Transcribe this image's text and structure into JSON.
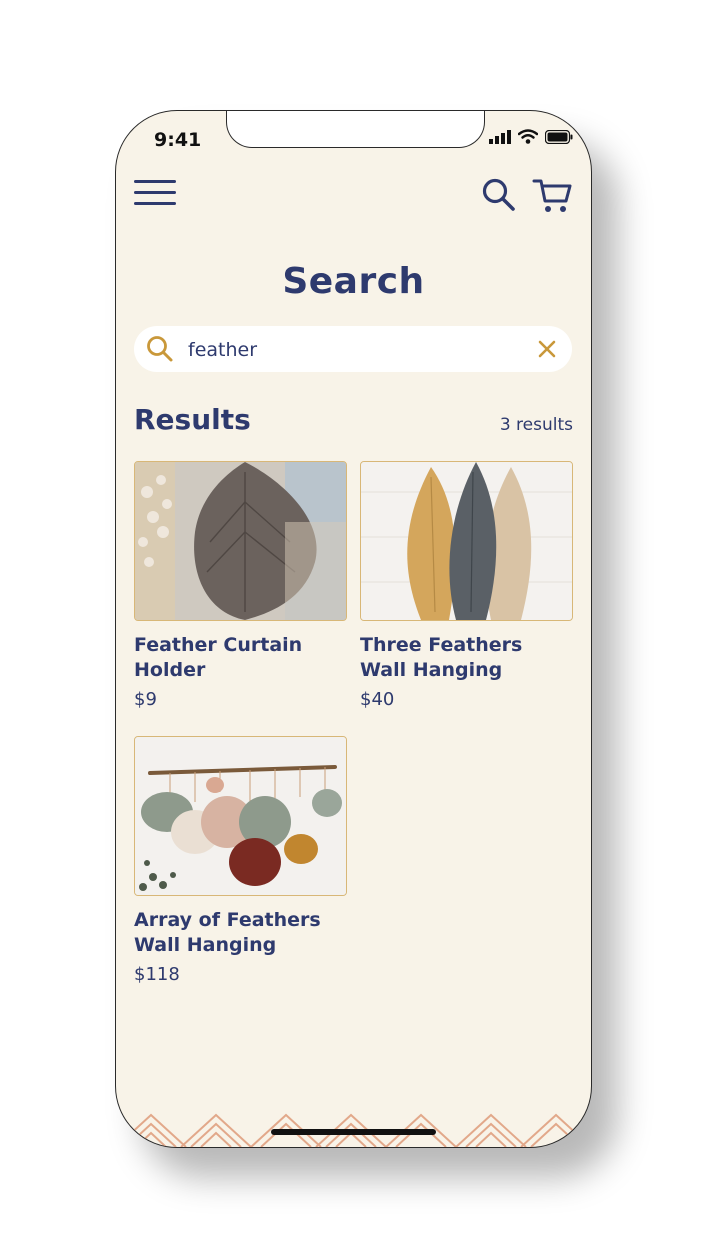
{
  "status": {
    "time": "9:41"
  },
  "header": {
    "title": "Search"
  },
  "search": {
    "value": "feather",
    "placeholder": "Search"
  },
  "results": {
    "heading": "Results",
    "count_text": "3 results",
    "items": [
      {
        "name": "Feather Curtain Holder",
        "price": "$9",
        "image": "grey macrame feather photo"
      },
      {
        "name": "Three Feathers Wall Hanging",
        "price": "$40",
        "image": "three macrame feathers photo"
      },
      {
        "name": "Array of Feathers Wall Hanging",
        "price": "$118",
        "image": "macrame leaves on branch photo"
      }
    ]
  },
  "colors": {
    "primary": "#2e3a6e",
    "accent": "#c9983a",
    "background": "#f8f3e8",
    "border": "#d8b777"
  },
  "icons": [
    "menu-icon",
    "search-icon",
    "cart-icon",
    "search-field-icon",
    "clear-icon",
    "signal-icon",
    "wifi-icon",
    "battery-icon"
  ]
}
